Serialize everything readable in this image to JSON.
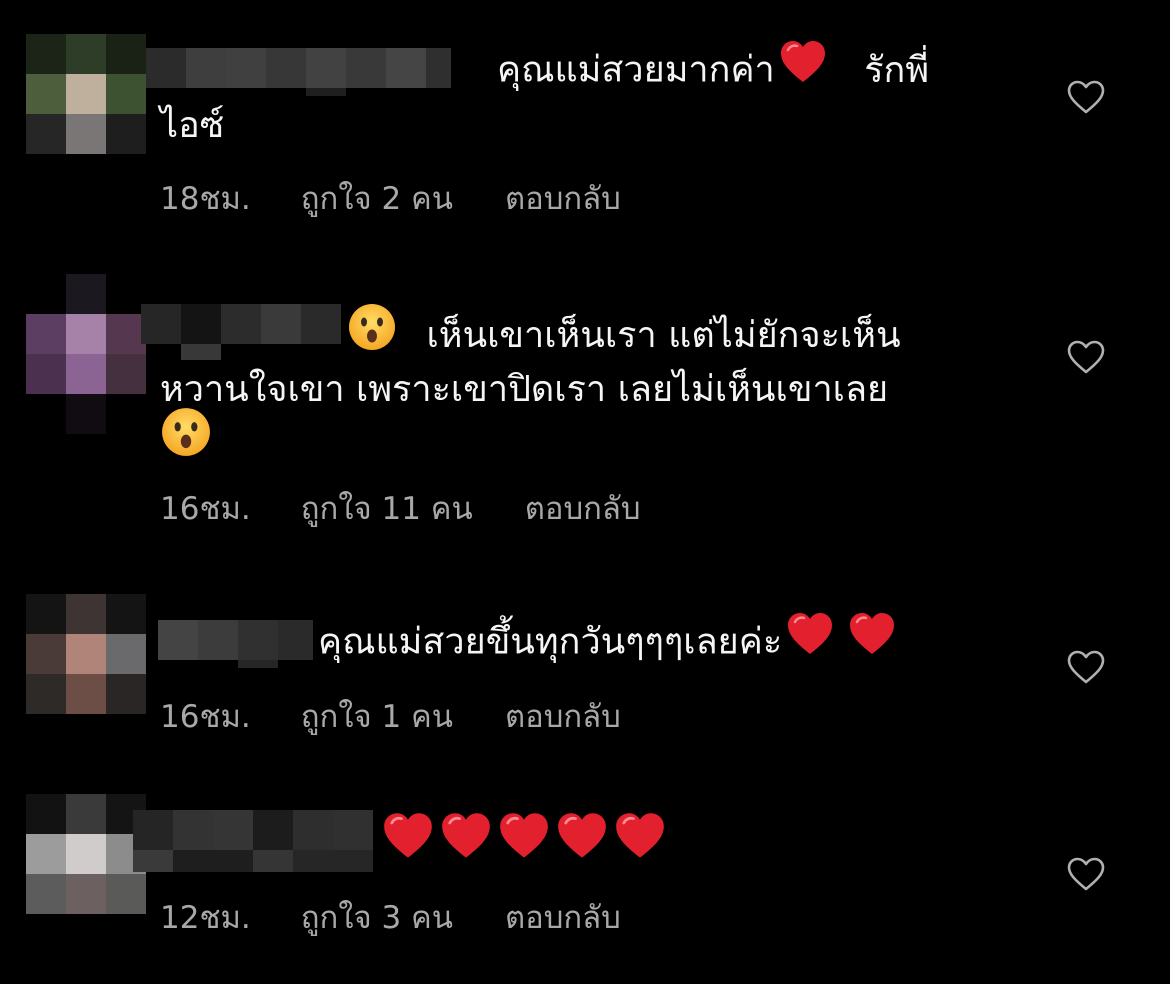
{
  "colors": {
    "background": "#000000",
    "text": "#f5f5f5",
    "meta": "#a8a8a8",
    "heart_emoji": "#e3202e"
  },
  "comments": [
    {
      "line1": "คุณแม่สวยมากค่า",
      "line1_after": "รักพี่",
      "line2": "ไอซ์",
      "time": "18ชม.",
      "likes": "ถูกใจ 2 คน",
      "reply": "ตอบกลับ",
      "emoji": [
        "red-heart"
      ]
    },
    {
      "line1": "เห็นเขาเห็นเรา แต่ไม่ยักจะเห็น",
      "line2": "หวานใจเขา เพราะเขาปิดเรา เลยไม่เห็นเขาเลย",
      "time": "16ชม.",
      "likes": "ถูกใจ 11 คน",
      "reply": "ตอบกลับ",
      "emoji": [
        "hushed-face",
        "hushed-face"
      ]
    },
    {
      "line1": "คุณแม่สวยขึ้นทุกวันๆๆๆเลยค่ะ",
      "time": "16ชม.",
      "likes": "ถูกใจ 1 คน",
      "reply": "ตอบกลับ",
      "emoji": [
        "red-heart",
        "red-heart"
      ]
    },
    {
      "time": "12ชม.",
      "likes": "ถูกใจ 3 คน",
      "reply": "ตอบกลับ",
      "emoji": [
        "red-heart",
        "red-heart",
        "red-heart",
        "red-heart",
        "red-heart"
      ]
    }
  ],
  "icons": {
    "like": "heart-outline-icon"
  }
}
